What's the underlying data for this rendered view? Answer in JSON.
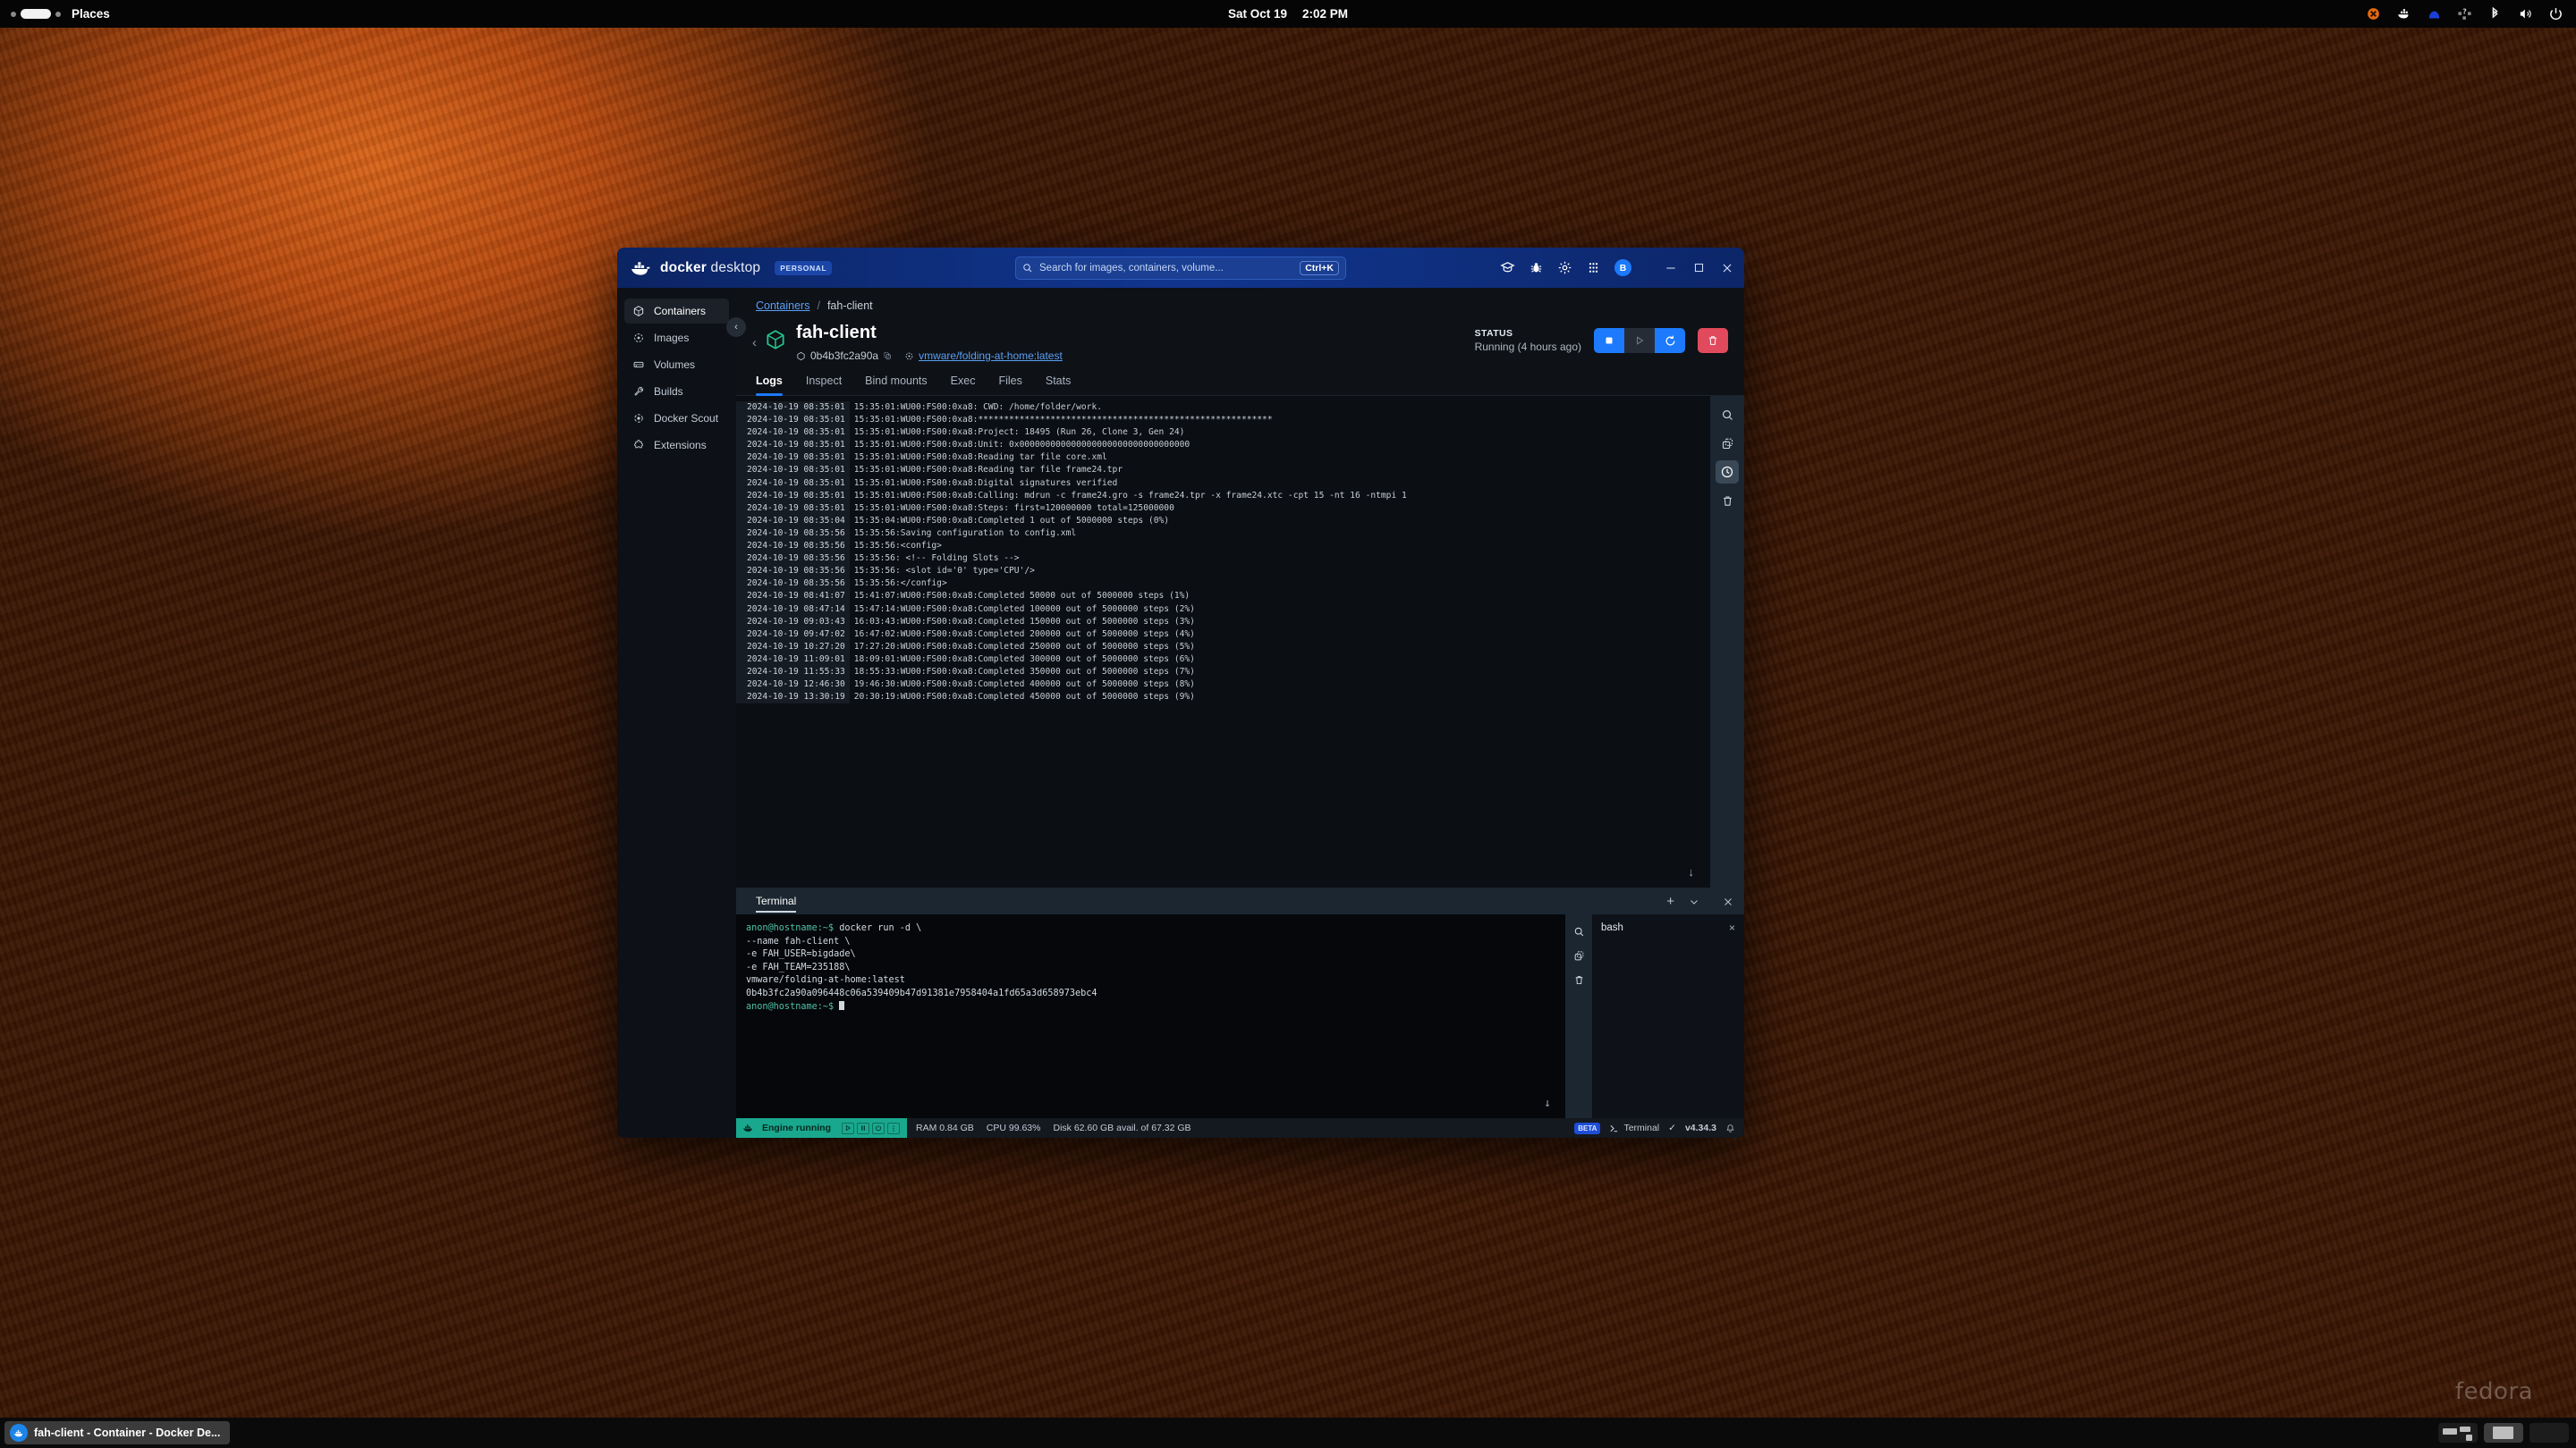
{
  "desktop": {
    "topbar": {
      "places_label": "Places",
      "clock_date": "Sat Oct 19",
      "clock_time": "2:02 PM",
      "tray_icons": [
        "x-circle-icon",
        "docker-whale-icon",
        "arch-icon",
        "unknown-app-icon",
        "bluetooth-icon",
        "volume-icon",
        "power-icon"
      ]
    },
    "taskbar": {
      "window_button_label": "fah-client - Container - Docker De...",
      "workspace_count": 3,
      "active_workspace": 2
    },
    "watermark": "fedora"
  },
  "window": {
    "titlebar": {
      "logo_bold": "docker",
      "logo_light": "desktop",
      "plan_badge": "PERSONAL",
      "search_placeholder": "Search for images, containers, volume...",
      "search_shortcut": "Ctrl+K",
      "icons": [
        "learning-center-icon",
        "bug-report-icon",
        "settings-gear-icon",
        "extensions-grid-icon"
      ],
      "account_initial": "B",
      "minimize": "minimize-icon",
      "maximize": "maximize-icon",
      "close": "close-icon"
    },
    "sidebar": {
      "items": [
        {
          "label": "Containers",
          "icon": "container-cube-icon",
          "active": true
        },
        {
          "label": "Images",
          "icon": "image-icon",
          "active": false
        },
        {
          "label": "Volumes",
          "icon": "volume-drive-icon",
          "active": false
        },
        {
          "label": "Builds",
          "icon": "wrench-icon",
          "active": false
        },
        {
          "label": "Docker Scout",
          "icon": "scout-icon",
          "active": false
        },
        {
          "label": "Extensions",
          "icon": "puzzle-icon",
          "active": false
        }
      ],
      "collapse_label": "‹"
    },
    "breadcrumb": {
      "root": "Containers",
      "separator": "/",
      "current": "fah-client"
    },
    "container": {
      "name": "fah-client",
      "id": "0b4b3fc2a90a",
      "image": "vmware/folding-at-home:latest",
      "status_label": "STATUS",
      "status_value": "Running (4 hours ago)",
      "actions": [
        {
          "name": "stop",
          "icon": "stop-square-icon",
          "state": "enabled"
        },
        {
          "name": "start",
          "icon": "play-triangle-icon",
          "state": "disabled"
        },
        {
          "name": "restart",
          "icon": "restart-arrow-icon",
          "state": "enabled"
        },
        {
          "name": "delete",
          "icon": "trash-icon",
          "state": "danger"
        }
      ]
    },
    "tabs": [
      {
        "label": "Logs",
        "active": true
      },
      {
        "label": "Inspect",
        "active": false
      },
      {
        "label": "Bind mounts",
        "active": false
      },
      {
        "label": "Exec",
        "active": false
      },
      {
        "label": "Files",
        "active": false
      },
      {
        "label": "Stats",
        "active": false
      }
    ],
    "logs": {
      "side_tools": [
        "search-icon",
        "copy-icon",
        "clock-icon",
        "trash-icon"
      ],
      "scroll_to_bottom": "chevron-down-icon",
      "lines": [
        {
          "ts": "2024-10-19 08:35:01",
          "msg": "15:35:01:WU00:FS00:0xa8:        CWD: /home/folder/work."
        },
        {
          "ts": "2024-10-19 08:35:01",
          "msg": "15:35:01:WU00:FS00:0xa8:*********************************************************"
        },
        {
          "ts": "2024-10-19 08:35:01",
          "msg": "15:35:01:WU00:FS00:0xa8:Project: 18495 (Run 26, Clone 3, Gen 24)"
        },
        {
          "ts": "2024-10-19 08:35:01",
          "msg": "15:35:01:WU00:FS00:0xa8:Unit: 0x000000000000000000000000000000000"
        },
        {
          "ts": "2024-10-19 08:35:01",
          "msg": "15:35:01:WU00:FS00:0xa8:Reading tar file core.xml"
        },
        {
          "ts": "2024-10-19 08:35:01",
          "msg": "15:35:01:WU00:FS00:0xa8:Reading tar file frame24.tpr"
        },
        {
          "ts": "2024-10-19 08:35:01",
          "msg": "15:35:01:WU00:FS00:0xa8:Digital signatures verified"
        },
        {
          "ts": "2024-10-19 08:35:01",
          "msg": "15:35:01:WU00:FS00:0xa8:Calling: mdrun -c frame24.gro -s frame24.tpr -x frame24.xtc -cpt 15 -nt 16 -ntmpi 1"
        },
        {
          "ts": "2024-10-19 08:35:01",
          "msg": "15:35:01:WU00:FS00:0xa8:Steps: first=120000000 total=125000000"
        },
        {
          "ts": "2024-10-19 08:35:04",
          "msg": "15:35:04:WU00:FS00:0xa8:Completed 1 out of 5000000 steps (0%)"
        },
        {
          "ts": "2024-10-19 08:35:56",
          "msg": "15:35:56:Saving configuration to config.xml"
        },
        {
          "ts": "2024-10-19 08:35:56",
          "msg": "15:35:56:<config>"
        },
        {
          "ts": "2024-10-19 08:35:56",
          "msg": "15:35:56:  <!-- Folding Slots -->"
        },
        {
          "ts": "2024-10-19 08:35:56",
          "msg": "15:35:56:  <slot id='0' type='CPU'/>"
        },
        {
          "ts": "2024-10-19 08:35:56",
          "msg": "15:35:56:</config>"
        },
        {
          "ts": "2024-10-19 08:41:07",
          "msg": "15:41:07:WU00:FS00:0xa8:Completed 50000 out of 5000000 steps (1%)"
        },
        {
          "ts": "2024-10-19 08:47:14",
          "msg": "15:47:14:WU00:FS00:0xa8:Completed 100000 out of 5000000 steps (2%)"
        },
        {
          "ts": "2024-10-19 09:03:43",
          "msg": "16:03:43:WU00:FS00:0xa8:Completed 150000 out of 5000000 steps (3%)"
        },
        {
          "ts": "2024-10-19 09:47:02",
          "msg": "16:47:02:WU00:FS00:0xa8:Completed 200000 out of 5000000 steps (4%)"
        },
        {
          "ts": "2024-10-19 10:27:20",
          "msg": "17:27:20:WU00:FS00:0xa8:Completed 250000 out of 5000000 steps (5%)"
        },
        {
          "ts": "2024-10-19 11:09:01",
          "msg": "18:09:01:WU00:FS00:0xa8:Completed 300000 out of 5000000 steps (6%)"
        },
        {
          "ts": "2024-10-19 11:55:33",
          "msg": "18:55:33:WU00:FS00:0xa8:Completed 350000 out of 5000000 steps (7%)"
        },
        {
          "ts": "2024-10-19 12:46:30",
          "msg": "19:46:30:WU00:FS00:0xa8:Completed 400000 out of 5000000 steps (8%)"
        },
        {
          "ts": "2024-10-19 13:30:19",
          "msg": "20:30:19:WU00:FS00:0xa8:Completed 450000 out of 5000000 steps (9%)"
        }
      ]
    },
    "terminal": {
      "title": "Terminal",
      "new_tab": "+",
      "dropdown": "chevron-down-icon",
      "close": "close-icon",
      "side_tools": [
        "search-icon",
        "copy-icon",
        "trash-icon"
      ],
      "session_tab": {
        "label": "bash",
        "close": "×"
      },
      "scroll_to_bottom": "chevron-down-icon",
      "prompt": "anon@hostname:~$",
      "lines": [
        {
          "type": "prompt",
          "prompt": "anon@hostname:~$",
          "text": " docker run -d \\"
        },
        {
          "type": "plain",
          "text": "  --name fah-client \\"
        },
        {
          "type": "plain",
          "text": "  -e FAH_USER=bigdade\\"
        },
        {
          "type": "plain",
          "text": "  -e FAH_TEAM=235188\\"
        },
        {
          "type": "plain",
          "text": "  vmware/folding-at-home:latest"
        },
        {
          "type": "plain",
          "text": "0b4b3fc2a90a096448c06a539409b47d91381e7958404a1fd65a3d658973ebc4"
        },
        {
          "type": "prompt-cursor",
          "prompt": "anon@hostname:~$",
          "text": " "
        }
      ]
    },
    "statusbar": {
      "engine_label": "Engine running",
      "engine_controls": [
        "play-icon",
        "pause-icon",
        "power-icon",
        "kebab-menu-icon"
      ],
      "ram": "RAM 0.84 GB",
      "cpu": "CPU 99.63%",
      "disk": "Disk 62.60 GB avail. of 67.32 GB",
      "beta_badge": "BETA",
      "terminal_label": "Terminal",
      "version": "v4.34.3",
      "version_check": "✓",
      "notification": "bell-icon"
    }
  },
  "colors": {
    "docker_blue": "#1d7afc",
    "titlebar_blue": "#11358f",
    "engine_teal": "#19a88d",
    "danger_red": "#e14a5c",
    "link_blue": "#5aa0f5"
  }
}
